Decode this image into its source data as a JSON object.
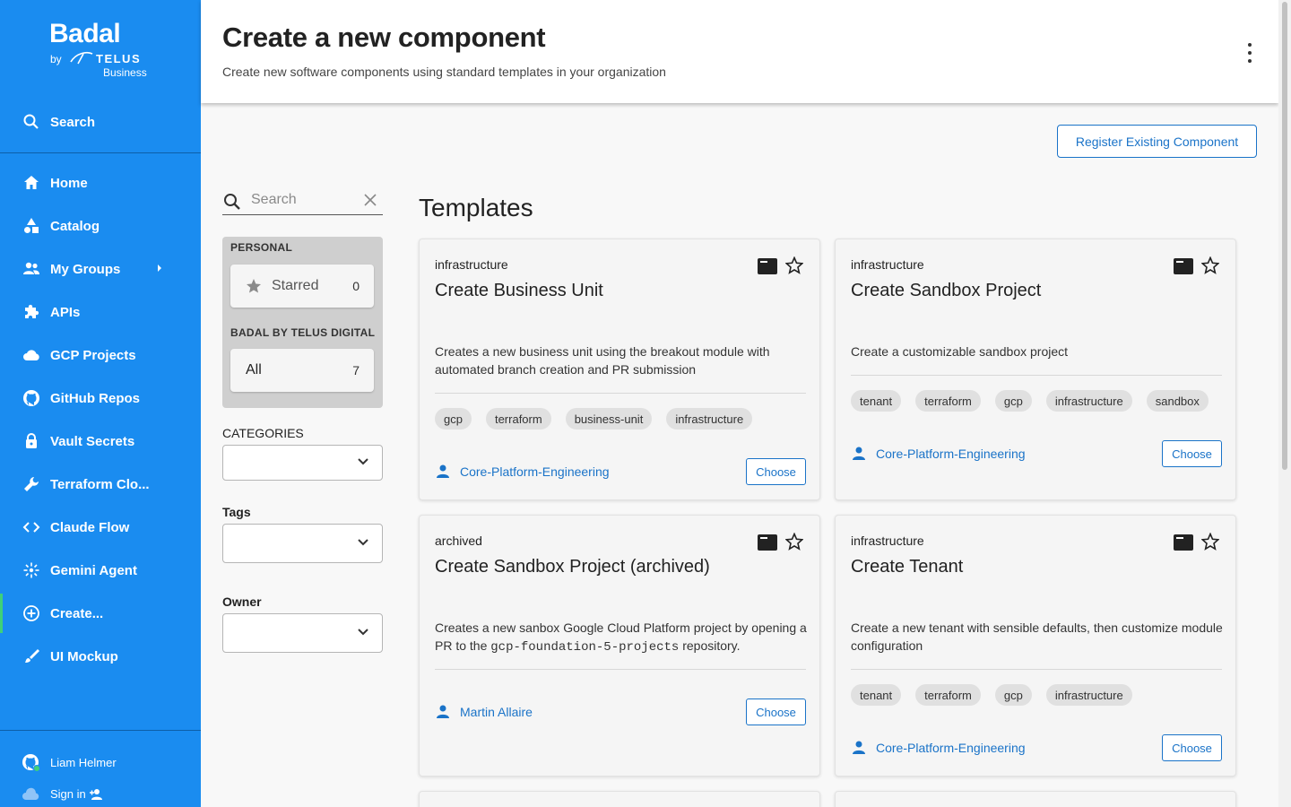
{
  "brand": {
    "name": "Badal",
    "by": "by",
    "telus": "TELUS",
    "business": "Business"
  },
  "sidebar": {
    "search_label": "Search",
    "items": [
      {
        "label": "Home",
        "icon": "home-icon"
      },
      {
        "label": "Catalog",
        "icon": "catalog-icon"
      },
      {
        "label": "My Groups",
        "icon": "groups-icon"
      },
      {
        "label": "APIs",
        "icon": "puzzle-icon"
      },
      {
        "label": "GCP Projects",
        "icon": "cloud-icon"
      },
      {
        "label": "GitHub Repos",
        "icon": "github-icon"
      },
      {
        "label": "Vault Secrets",
        "icon": "lock-icon"
      },
      {
        "label": "Terraform Clo...",
        "icon": "wrench-icon"
      },
      {
        "label": "Claude Flow",
        "icon": "code-icon"
      },
      {
        "label": "Gemini Agent",
        "icon": "sparkle-icon"
      },
      {
        "label": "Create...",
        "icon": "add-circle-icon"
      },
      {
        "label": "UI Mockup",
        "icon": "brush-icon"
      }
    ],
    "user_name": "Liam Helmer",
    "sign_in_label": "Sign in"
  },
  "header": {
    "title": "Create a new component",
    "subtitle": "Create new software components using standard templates in your organization"
  },
  "register_button": "Register Existing Component",
  "filters": {
    "search_placeholder": "Search",
    "personal_title": "PERSONAL",
    "starred_label": "Starred",
    "starred_count": "0",
    "org_title": "BADAL BY TELUS DIGITAL",
    "all_label": "All",
    "all_count": "7",
    "categories_label": "CATEGORIES",
    "tags_label": "Tags",
    "owner_label": "Owner"
  },
  "templates_heading": "Templates",
  "choose_label": "Choose",
  "cards": [
    {
      "type": "infrastructure",
      "title": "Create Business Unit",
      "description": "Creates a new business unit using the breakout module with automated branch creation and PR submission",
      "tags": [
        "gcp",
        "terraform",
        "business-unit",
        "infrastructure"
      ],
      "owner": "Core-Platform-Engineering"
    },
    {
      "type": "infrastructure",
      "title": "Create Sandbox Project",
      "description": "Create a customizable sandbox project",
      "tags": [
        "tenant",
        "terraform",
        "gcp",
        "infrastructure",
        "sandbox"
      ],
      "owner": "Core-Platform-Engineering"
    },
    {
      "type": "archived",
      "title": "Create Sandbox Project (archived)",
      "description_pre": "Creates a new sanbox Google Cloud Platform project by opening a PR to the",
      "description_code": "gcp-foundation-5-projects",
      "description_post": "repository.",
      "tags": [],
      "owner": "Martin Allaire"
    },
    {
      "type": "infrastructure",
      "title": "Create Tenant",
      "description": "Create a new tenant with sensible defaults, then customize module configuration",
      "tags": [
        "tenant",
        "terraform",
        "gcp",
        "infrastructure"
      ],
      "owner": "Core-Platform-Engineering"
    }
  ]
}
